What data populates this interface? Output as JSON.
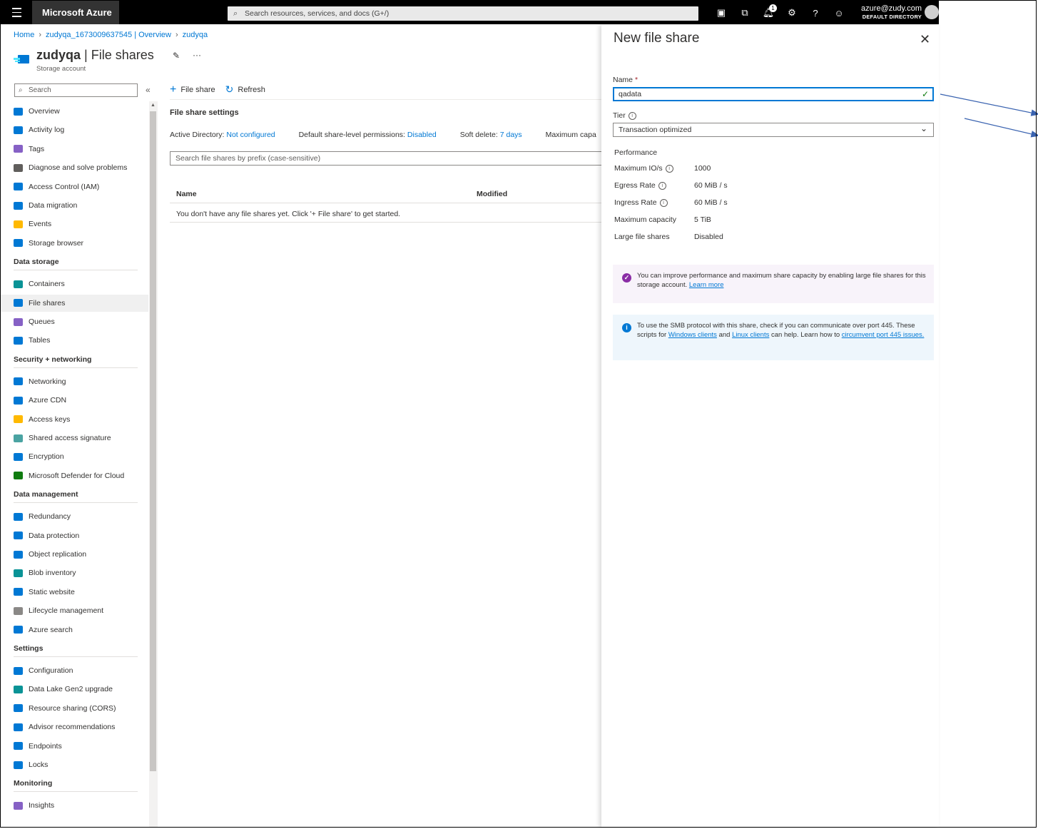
{
  "topbar": {
    "brand": "Microsoft Azure",
    "search_placeholder": "Search resources, services, and docs (G+/)",
    "notification_count": "1",
    "account_email": "azure@zudy.com",
    "account_directory": "DEFAULT DIRECTORY",
    "icons": [
      "cloud-shell-icon",
      "directory-filter-icon",
      "notifications-icon",
      "settings-icon",
      "help-icon",
      "feedback-icon"
    ]
  },
  "breadcrumb": {
    "home": "Home",
    "overview": "zudyqa_1673009637545 | Overview",
    "current": "zudyqa"
  },
  "header": {
    "name": "zudyqa",
    "page": "| File shares",
    "subtitle": "Storage account",
    "more": "···"
  },
  "sidebar": {
    "search_placeholder": "Search",
    "collapse": "«",
    "items": [
      {
        "label": "Overview",
        "color": "#0078d4"
      },
      {
        "label": "Activity log",
        "color": "#0078d4"
      },
      {
        "label": "Tags",
        "color": "#8661c5"
      },
      {
        "label": "Diagnose and solve problems",
        "color": "#605e5c"
      },
      {
        "label": "Access Control (IAM)",
        "color": "#0078d4"
      },
      {
        "label": "Data migration",
        "color": "#0078d4"
      },
      {
        "label": "Events",
        "color": "#ffb900"
      },
      {
        "label": "Storage browser",
        "color": "#0078d4"
      }
    ],
    "sections": [
      {
        "title": "Data storage",
        "items": [
          {
            "label": "Containers",
            "color": "#0a9396"
          },
          {
            "label": "File shares",
            "color": "#0078d4"
          },
          {
            "label": "Queues",
            "color": "#8661c5"
          },
          {
            "label": "Tables",
            "color": "#0078d4"
          }
        ]
      },
      {
        "title": "Security + networking",
        "items": [
          {
            "label": "Networking",
            "color": "#0078d4"
          },
          {
            "label": "Azure CDN",
            "color": "#0078d4"
          },
          {
            "label": "Access keys",
            "color": "#ffb900"
          },
          {
            "label": "Shared access signature",
            "color": "#4aa3a2"
          },
          {
            "label": "Encryption",
            "color": "#0078d4"
          },
          {
            "label": "Microsoft Defender for Cloud",
            "color": "#107c10"
          }
        ]
      },
      {
        "title": "Data management",
        "items": [
          {
            "label": "Redundancy",
            "color": "#0078d4"
          },
          {
            "label": "Data protection",
            "color": "#0078d4"
          },
          {
            "label": "Object replication",
            "color": "#0078d4"
          },
          {
            "label": "Blob inventory",
            "color": "#0a9396"
          },
          {
            "label": "Static website",
            "color": "#0078d4"
          },
          {
            "label": "Lifecycle management",
            "color": "#8a8886"
          },
          {
            "label": "Azure search",
            "color": "#0078d4"
          }
        ]
      },
      {
        "title": "Settings",
        "items": [
          {
            "label": "Configuration",
            "color": "#0078d4"
          },
          {
            "label": "Data Lake Gen2 upgrade",
            "color": "#0a9396"
          },
          {
            "label": "Resource sharing (CORS)",
            "color": "#0078d4"
          },
          {
            "label": "Advisor recommendations",
            "color": "#0078d4"
          },
          {
            "label": "Endpoints",
            "color": "#0078d4"
          },
          {
            "label": "Locks",
            "color": "#0078d4"
          }
        ]
      },
      {
        "title": "Monitoring",
        "items": [
          {
            "label": "Insights",
            "color": "#8661c5"
          }
        ]
      }
    ]
  },
  "main": {
    "add_file_share": "File share",
    "refresh": "Refresh",
    "settings_title": "File share settings",
    "active_directory_label": "Active Directory:",
    "active_directory_value": "Not configured",
    "permissions_label": "Default share-level permissions:",
    "permissions_value": "Disabled",
    "soft_delete_label": "Soft delete:",
    "soft_delete_value": "7 days",
    "max_capacity_label": "Maximum capa",
    "search_placeholder": "Search file shares by prefix (case-sensitive)",
    "columns": [
      "Name",
      "Modified"
    ],
    "empty_message": "You don't have any file shares yet. Click '+ File share' to get started."
  },
  "panel": {
    "title": "New file share",
    "close": "✕",
    "name_label": "Name",
    "required_mark": "*",
    "name_value": "qadata",
    "tier_label": "Tier",
    "tier_value": "Transaction optimized",
    "performance_title": "Performance",
    "performance": [
      {
        "key": "Maximum IO/s",
        "value": "1000",
        "info": true
      },
      {
        "key": "Egress Rate",
        "value": "60 MiB / s",
        "info": true
      },
      {
        "key": "Ingress Rate",
        "value": "60 MiB / s",
        "info": true
      },
      {
        "key": "Maximum capacity",
        "value": "5 TiB",
        "info": false
      },
      {
        "key": "Large file shares",
        "value": "Disabled",
        "info": false
      }
    ],
    "msg_large": "You can improve performance and maximum share capacity by enabling large file shares for this storage account.",
    "msg_large_link": "Learn more",
    "msg_smb_1": "To use the SMB protocol with this share, check if you can communicate over port 445. These scripts for",
    "msg_smb_link1": "Windows clients",
    "msg_smb_and": "and",
    "msg_smb_link2": "Linux clients",
    "msg_smb_2": "can help. Learn how to",
    "msg_smb_link3": "circumvent port 445 issues."
  },
  "colors": {
    "accent": "#0078d4",
    "topbar": "#000000",
    "annotation_arrow": "#3a63b0"
  }
}
